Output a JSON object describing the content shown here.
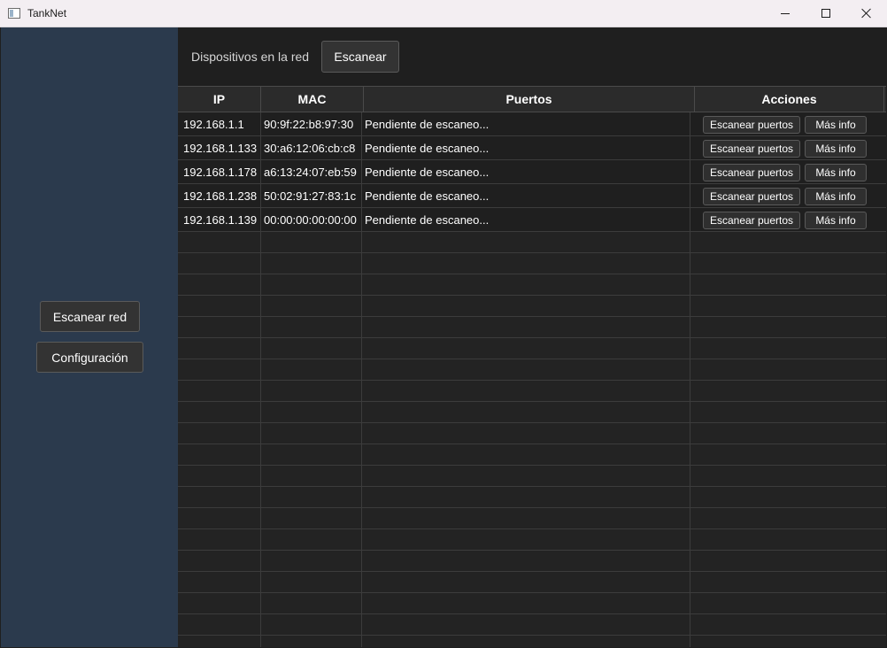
{
  "window": {
    "title": "TankNet",
    "icon": "app-window-icon",
    "controls": [
      "minimize-icon",
      "maximize-icon",
      "close-icon"
    ]
  },
  "sidebar": {
    "scan_network_label": "Escanear red",
    "settings_label": "Configuración"
  },
  "header": {
    "label": "Dispositivos en la red",
    "scan_button": "Escanear"
  },
  "table": {
    "columns": [
      "IP",
      "MAC",
      "Puertos",
      "Acciones"
    ],
    "rows": [
      {
        "ip": "192.168.1.1",
        "mac": "90:9f:22:b8:97:30",
        "ports": "Pendiente de escaneo...",
        "scan_ports": "Escanear puertos",
        "more_info": "Más info"
      },
      {
        "ip": "192.168.1.133",
        "mac": "30:a6:12:06:cb:c8",
        "ports": "Pendiente de escaneo...",
        "scan_ports": "Escanear puertos",
        "more_info": "Más info"
      },
      {
        "ip": "192.168.1.178",
        "mac": "a6:13:24:07:eb:59",
        "ports": "Pendiente de escaneo...",
        "scan_ports": "Escanear puertos",
        "more_info": "Más info"
      },
      {
        "ip": "192.168.1.238",
        "mac": "50:02:91:27:83:1c",
        "ports": "Pendiente de escaneo...",
        "scan_ports": "Escanear puertos",
        "more_info": "Más info"
      },
      {
        "ip": "192.168.1.139",
        "mac": "00:00:00:00:00:00",
        "ports": "Pendiente de escaneo...",
        "scan_ports": "Escanear puertos",
        "more_info": "Más info"
      }
    ]
  },
  "colors": {
    "sidebar_bg": "#2b3a4d",
    "main_bg": "#1f1f1f",
    "titlebar_bg": "#f3eef2",
    "button_bg": "#333333"
  }
}
